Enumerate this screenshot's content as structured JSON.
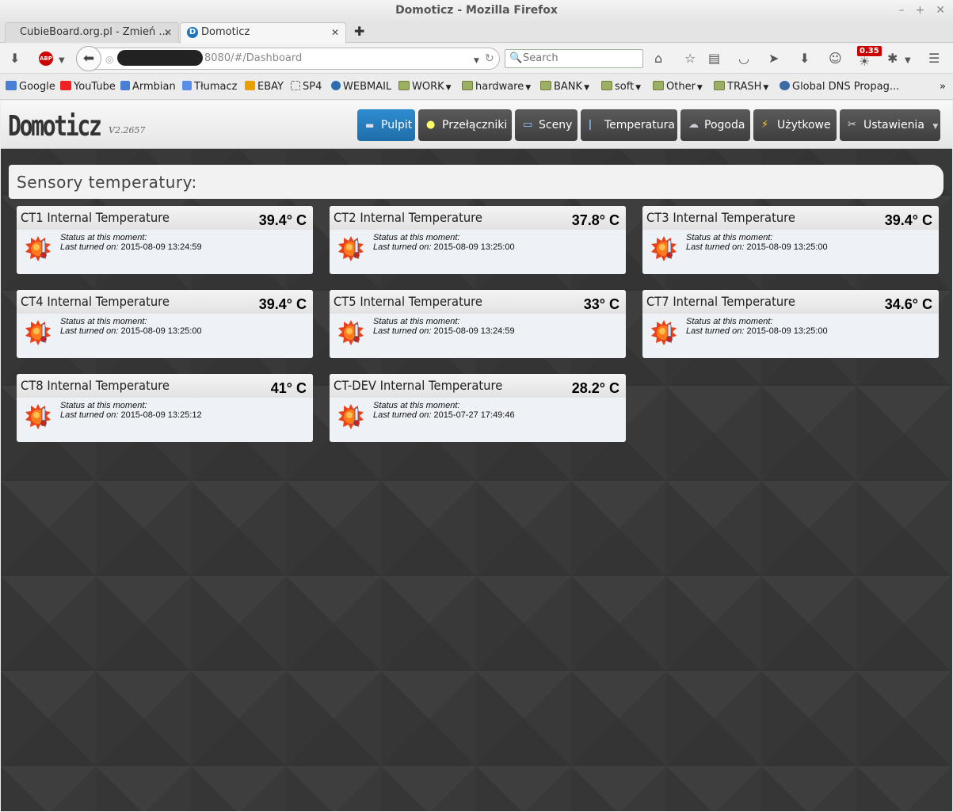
{
  "window": {
    "title": "Domoticz - Mozilla Firefox",
    "controls": [
      "–",
      "+",
      "✕"
    ]
  },
  "tabs": [
    {
      "label": "CubieBoard.org.pl - Zmień ...",
      "close": "✕"
    },
    {
      "label": "Domoticz",
      "close": "✕"
    }
  ],
  "new_tab": "✚",
  "nav": {
    "url_text": "8080/#/Dashboard",
    "search_placeholder": "Search",
    "badge": "0.35"
  },
  "bookmarks": [
    {
      "label": "Google",
      "icon": "google-icon"
    },
    {
      "label": "YouTube",
      "icon": "youtube-icon"
    },
    {
      "label": "Armbian",
      "icon": "armbian-icon"
    },
    {
      "label": "Tłumacz",
      "icon": "translate-icon"
    },
    {
      "label": "EBAY",
      "icon": "ebay-icon"
    },
    {
      "label": "SP4",
      "icon": "page-icon"
    },
    {
      "label": "WEBMAIL",
      "icon": "mail-icon"
    },
    {
      "label": "WORK",
      "icon": "folder-icon"
    },
    {
      "label": "hardware",
      "icon": "folder-icon"
    },
    {
      "label": "BANK",
      "icon": "folder-icon"
    },
    {
      "label": "soft",
      "icon": "folder-icon"
    },
    {
      "label": "Other",
      "icon": "folder-icon"
    },
    {
      "label": "TRASH",
      "icon": "folder-icon"
    },
    {
      "label": "Global DNS Propag...",
      "icon": "globe-icon"
    }
  ],
  "bookmark_overflow": "»",
  "app": {
    "logo": "Domoticz",
    "version": "V2.2657",
    "menu": [
      {
        "label": "Pulpit",
        "icon": "▬"
      },
      {
        "label": "Przełączniki",
        "icon": "💡"
      },
      {
        "label": "Sceny",
        "icon": "▭"
      },
      {
        "label": "Temperatura",
        "icon": "🌡"
      },
      {
        "label": "Pogoda",
        "icon": "☁"
      },
      {
        "label": "Użytkowe",
        "icon": "⚡"
      },
      {
        "label": "Ustawienia",
        "icon": "✂"
      }
    ],
    "section_title": "Sensory temperatury:",
    "status_label": "Status at this moment:",
    "last_label": "Last turned on:",
    "sensors": [
      {
        "name": "CT1 Internal Temperature",
        "value": "39.4° C",
        "last": "2015-08-09 13:24:59"
      },
      {
        "name": "CT2 Internal Temperature",
        "value": "37.8° C",
        "last": "2015-08-09 13:25:00"
      },
      {
        "name": "CT3 Internal Temperature",
        "value": "39.4° C",
        "last": "2015-08-09 13:25:00"
      },
      {
        "name": "CT4 Internal Temperature",
        "value": "39.4° C",
        "last": "2015-08-09 13:25:00"
      },
      {
        "name": "CT5 Internal Temperature",
        "value": "33° C",
        "last": "2015-08-09 13:24:59"
      },
      {
        "name": "CT7 Internal Temperature",
        "value": "34.6° C",
        "last": "2015-08-09 13:25:00"
      },
      {
        "name": "CT8 Internal Temperature",
        "value": "41° C",
        "last": "2015-08-09 13:25:12"
      },
      {
        "name": "CT-DEV Internal Temperature",
        "value": "28.2° C",
        "last": "2015-07-27 17:49:46"
      }
    ]
  },
  "colors": {
    "accent": "#1e73be",
    "dark_bg": "#393939",
    "menu_bg": "#4a4a4a"
  }
}
